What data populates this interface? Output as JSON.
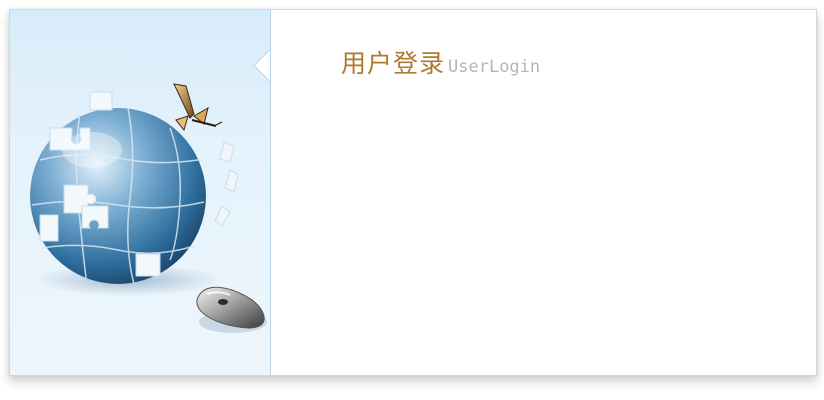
{
  "login_header": {
    "title_cn": "用户登录",
    "title_en": "UserLogin"
  },
  "illustration": {
    "icons": [
      "globe-puzzle-icon",
      "butterfly-icon",
      "computer-mouse-icon"
    ]
  },
  "colors": {
    "title_cn": "#b07a2e",
    "title_en": "#b5b5b5",
    "left_panel_bg": "#e6f3fc",
    "globe_blue": "#2f6f9e"
  }
}
